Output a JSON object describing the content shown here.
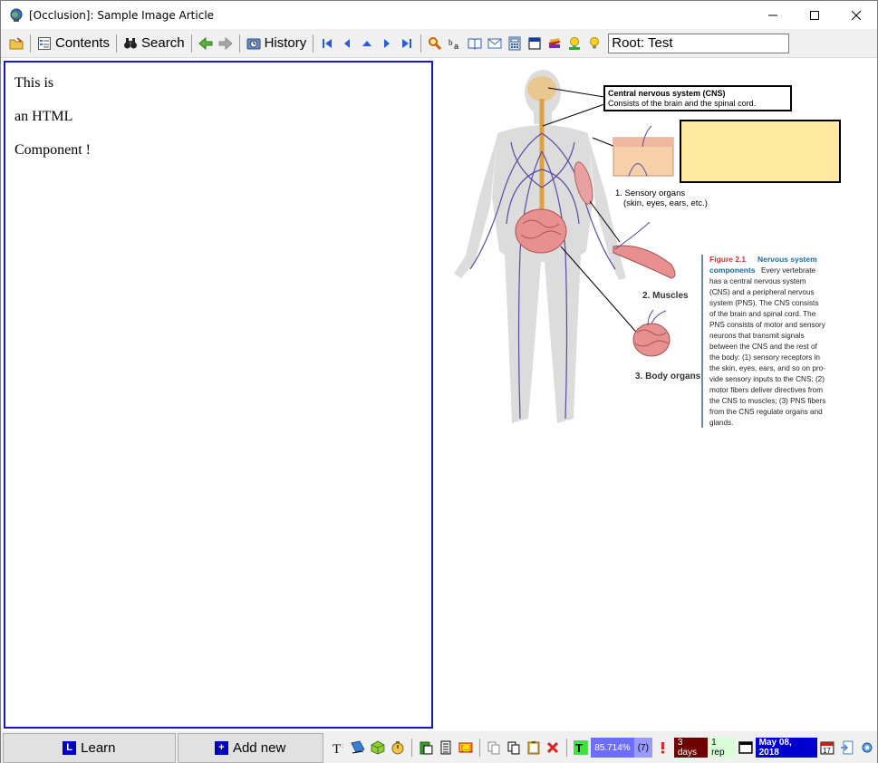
{
  "window": {
    "title": "[Occlusion]: Sample Image Article"
  },
  "toolbar": {
    "contents_label": "Contents",
    "search_label": "Search",
    "history_label": "History",
    "root_value": "Root: Test"
  },
  "html_component": {
    "lines": [
      "This is",
      "an HTML",
      "Component !"
    ]
  },
  "figure": {
    "cns_label_title": "Central nervous system (CNS)",
    "cns_label_text": "Consists of the brain and the spinal cord.",
    "occlusion_color": "#ffeaa0",
    "sensory_label_1": "1. Sensory organs",
    "sensory_label_2": "(skin, eyes, ears, etc.)",
    "muscles_label": "2. Muscles",
    "organs_label": "3. Body organs",
    "caption_fig": "Figure 2.1",
    "caption_title_1": "Nervous system",
    "caption_title_2": "components",
    "caption_lines": [
      "Every vertebrate",
      "has a central nervous system",
      "(CNS) and a peripheral nervous",
      "system (PNS). The CNS consists",
      "of the brain and spinal cord. The",
      "PNS consists of motor and sensory",
      "neurons that transmit signals",
      "between the CNS and the rest of",
      "the body: (1) sensory receptors in",
      "the skin, eyes, ears, and so on pro-",
      "vide sensory inputs to the CNS; (2)",
      "motor fibers deliver directives from",
      "the CNS to muscles; (3) PNS fibers",
      "from the CNS regulate organs and",
      "glands."
    ]
  },
  "bottombar": {
    "learn_label": "Learn",
    "learn_icon_letter": "L",
    "add_new_label": "Add new",
    "add_new_icon_letter": "+",
    "percent": "85.714%",
    "count": "(7)",
    "interval": "3 days",
    "reps": "1 rep",
    "date": "May 08, 2018",
    "calendar_day": "17"
  },
  "colors": {
    "pane_border": "#1414c8",
    "percent_bg": "#6d6dfc",
    "interval_bg": "#6e0000",
    "reps_bg": "#d8ffd8",
    "date_bg": "#0000d0"
  }
}
